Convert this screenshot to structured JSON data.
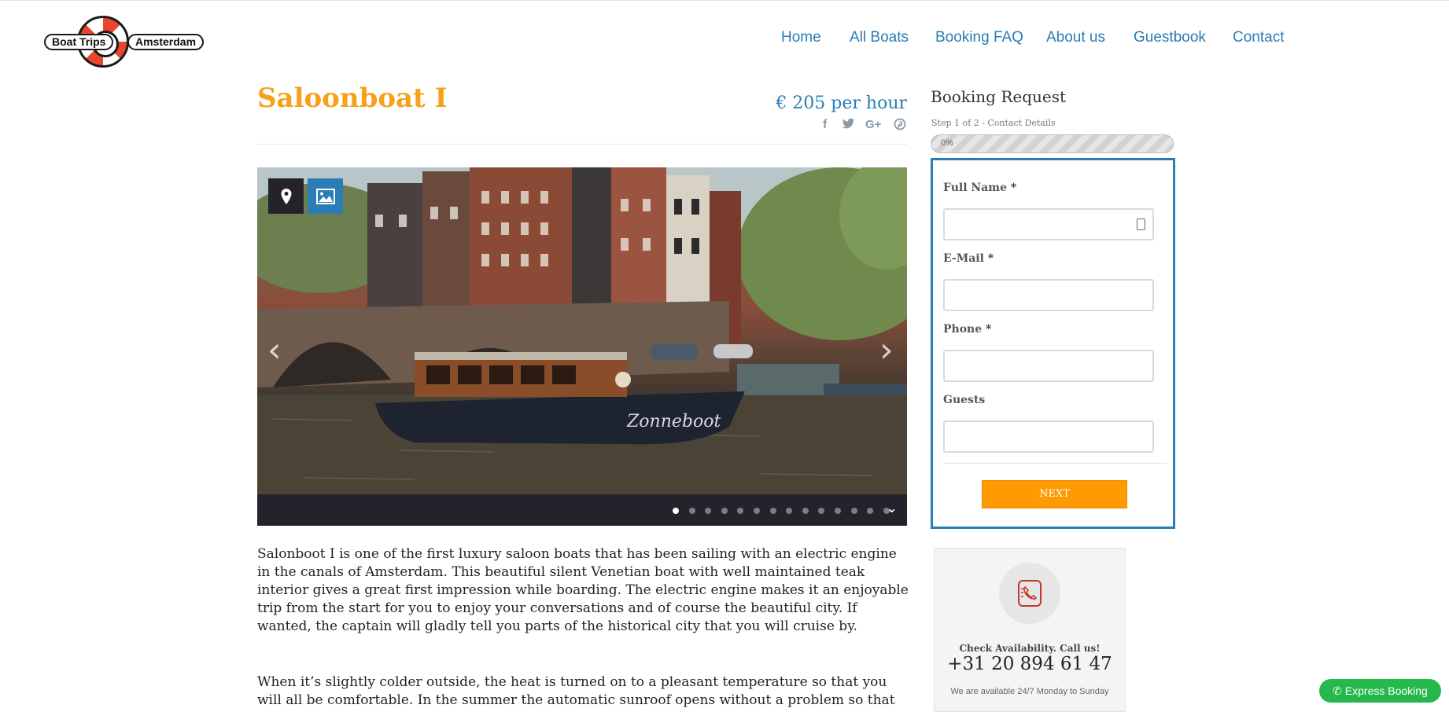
{
  "header": {
    "logo_left": "Boat Trips",
    "logo_right": "Amsterdam",
    "nav": [
      "Home",
      "All Boats",
      "Booking FAQ",
      "About us",
      "Guestbook",
      "Contact"
    ]
  },
  "boat": {
    "title": "Saloonboat I",
    "price": "€ 205 per hour",
    "share_icons": [
      "facebook-icon",
      "twitter-icon",
      "google-plus-icon",
      "pinterest-icon"
    ]
  },
  "gallery": {
    "icons": [
      "map-pin-icon",
      "image-icon"
    ],
    "slide_count": 14,
    "active_slide": 1,
    "boat_name": "Zonneboot"
  },
  "description": {
    "p1": "Salonboot I is one of the first luxury saloon boats that has been sailing with an electric engine in the canals of Amsterdam. This beautiful silent Venetian boat with well maintained teak interior gives a great first impression while boarding. The electric engine makes it an enjoyable trip from the start for you to enjoy your conversations and of course the beautiful city. If wanted, the captain will gladly tell you parts of the historical city that you will cruise by.",
    "p2": "When it’s slightly colder outside, the heat is turned on to a pleasant temperature so that you will all be comfortable. In the summer the automatic sunroof opens without a problem so that you and your"
  },
  "booking": {
    "title": "Booking Request",
    "step": "Step 1 of 2 - Contact Details",
    "progress_label": "0%",
    "progress": 0,
    "fields": [
      {
        "label": "Full Name",
        "required": "*",
        "value": ""
      },
      {
        "label": "E-Mail",
        "required": "*",
        "value": ""
      },
      {
        "label": "Phone",
        "required": "*",
        "value": ""
      },
      {
        "label": "Guests",
        "required": "",
        "value": ""
      }
    ],
    "next_label": "NEXT"
  },
  "callbox": {
    "headline": "Check Availability. Call us!",
    "phone": "+31 20 894 61 47",
    "availability": "We are available 24/7 Monday to Sunday"
  },
  "express": {
    "label": "Express Booking"
  },
  "colors": {
    "accent_blue": "#2a7db5",
    "accent_orange": "#f5a11a",
    "button_orange": "#ff9a00",
    "whatsapp_green": "#25b84c"
  }
}
